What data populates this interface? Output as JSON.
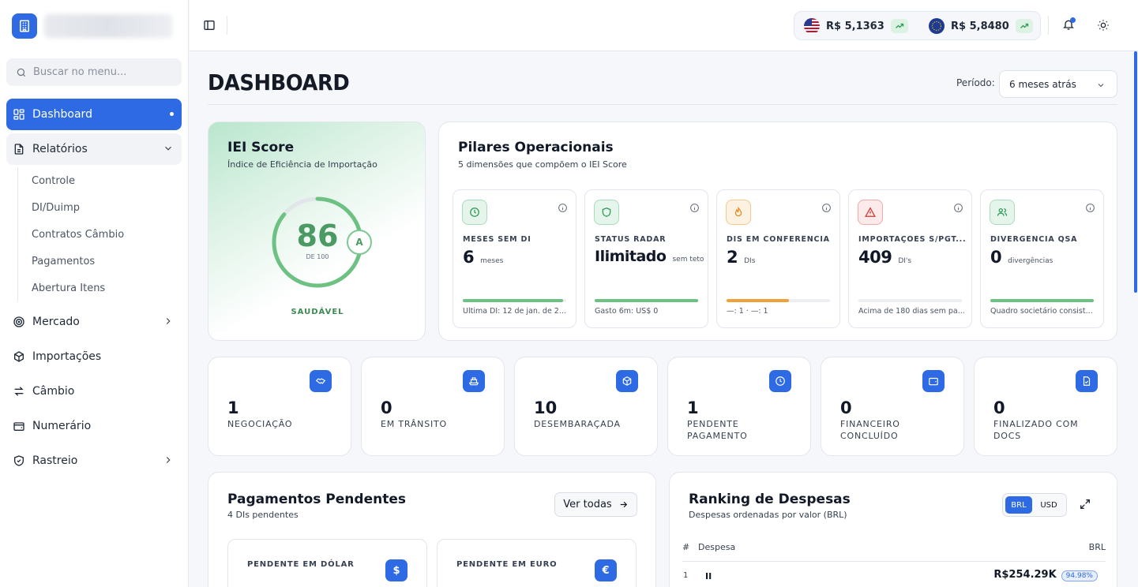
{
  "sidebar": {
    "search_placeholder": "Buscar no menu...",
    "items": [
      {
        "label": "Dashboard"
      },
      {
        "label": "Relatórios"
      },
      {
        "label": "Mercado"
      },
      {
        "label": "Importações"
      },
      {
        "label": "Câmbio"
      },
      {
        "label": "Numerário"
      },
      {
        "label": "Rastreio"
      }
    ],
    "sub_items": [
      "Controle",
      "DI/Duimp",
      "Contratos Câmbio",
      "Pagamentos",
      "Abertura Itens"
    ]
  },
  "topbar": {
    "usd_rate": "R$ 5,1363",
    "eur_rate": "R$ 5,8480"
  },
  "page": {
    "title": "DASHBOARD",
    "period_label": "Período:",
    "period_value": "6 meses atrás"
  },
  "iei": {
    "title": "IEI Score",
    "subtitle": "Índice de Eficiência de Importação",
    "score": "86",
    "score_max": "DE 100",
    "score_fraction": 0.86,
    "grade": "A",
    "status": "SAUDÁVEL",
    "color": "#6cc183"
  },
  "pilares": {
    "title": "Pilares Operacionais",
    "subtitle": "5 dimensões que compõem o IEI Score",
    "cards": [
      {
        "label": "MESES SEM DI",
        "value": "6",
        "unit": "meses",
        "footer": "Última DI: 12 de jan. de 2...",
        "progress": 0.97,
        "color": "#6cc183",
        "icon": "clock-icon"
      },
      {
        "label": "STATUS RADAR",
        "value": "Ilimitado",
        "unit": "sem teto",
        "footer": "Gasto 6m: US$ 0",
        "progress": 1.0,
        "color": "#6cc183",
        "icon": "shield-icon"
      },
      {
        "label": "DIS EM CONFERÊNCIA",
        "value": "2",
        "unit": "DIs",
        "footer": "—: 1 · —: 1",
        "progress": 0.6,
        "color": "#f0a13a",
        "icon": "flame-icon"
      },
      {
        "label": "IMPORTAÇÕES S/PGT...",
        "value": "409",
        "unit": "DI's",
        "footer": "Acima de 180 dias sem pa...",
        "progress": 0.0,
        "color": "#e0443e",
        "icon": "warning-icon"
      },
      {
        "label": "DIVERGÊNCIA QSA",
        "value": "0",
        "unit": "divergências",
        "footer": "Quadro societário consist...",
        "progress": 1.0,
        "color": "#6cc183",
        "icon": "users-icon"
      }
    ]
  },
  "stats": [
    {
      "value": "1",
      "label": "NEGOCIAÇÃO",
      "icon": "handshake-icon"
    },
    {
      "value": "0",
      "label": "EM TRÂNSITO",
      "icon": "ship-icon"
    },
    {
      "value": "10",
      "label": "DESEMBARAÇADA",
      "icon": "package-icon"
    },
    {
      "value": "1",
      "label": "PENDENTE PAGAMENTO",
      "icon": "clock-icon"
    },
    {
      "value": "0",
      "label": "FINANCEIRO CONCLUÍDO",
      "icon": "wallet-icon"
    },
    {
      "value": "0",
      "label": "FINALIZADO COM DOCS",
      "icon": "document-check-icon"
    }
  ],
  "pendentes": {
    "title": "Pagamentos Pendentes",
    "subtitle": "4 DIs pendentes",
    "button": "Ver todas",
    "cards": [
      {
        "label": "PENDENTE EM DÓLAR",
        "symbol": "$"
      },
      {
        "label": "PENDENTE EM EURO",
        "symbol": "€"
      }
    ]
  },
  "ranking": {
    "title": "Ranking de Despesas",
    "subtitle": "Despesas ordenadas por valor (BRL)",
    "currency_options": [
      "BRL",
      "USD"
    ],
    "selected_currency": "BRL",
    "columns": [
      "#",
      "Despesa",
      "BRL"
    ],
    "rows": [
      {
        "rank": "1",
        "name": "II",
        "value": "R$254.29K",
        "pct": "94.98%"
      }
    ]
  },
  "colors": {
    "accent": "#2d6ae3",
    "success": "#6cc183",
    "warning": "#f0a13a",
    "danger": "#e0443e"
  }
}
